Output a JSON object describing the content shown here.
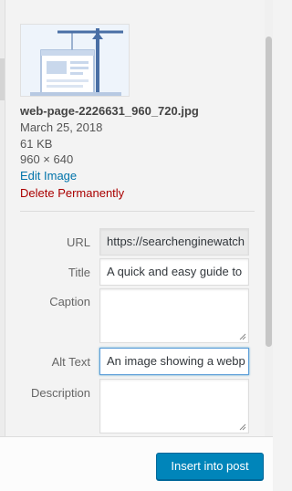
{
  "attachment": {
    "filename": "web-page-2226631_960_720.jpg",
    "date": "March 25, 2018",
    "filesize": "61 KB",
    "dimensions": "960 × 640",
    "edit_link": "Edit Image",
    "delete_link": "Delete Permanently"
  },
  "fields": {
    "url": {
      "label": "URL",
      "value": "https://searchenginewatch"
    },
    "title": {
      "label": "Title",
      "value": "A quick and easy guide to"
    },
    "caption": {
      "label": "Caption",
      "value": ""
    },
    "alt_text": {
      "label": "Alt Text",
      "value": "An image showing a webp"
    },
    "description": {
      "label": "Description",
      "value": ""
    }
  },
  "footer": {
    "insert_label": "Insert into post"
  },
  "colors": {
    "link": "#0073aa",
    "delete": "#aa0000",
    "primary_button": "#0085ba"
  }
}
